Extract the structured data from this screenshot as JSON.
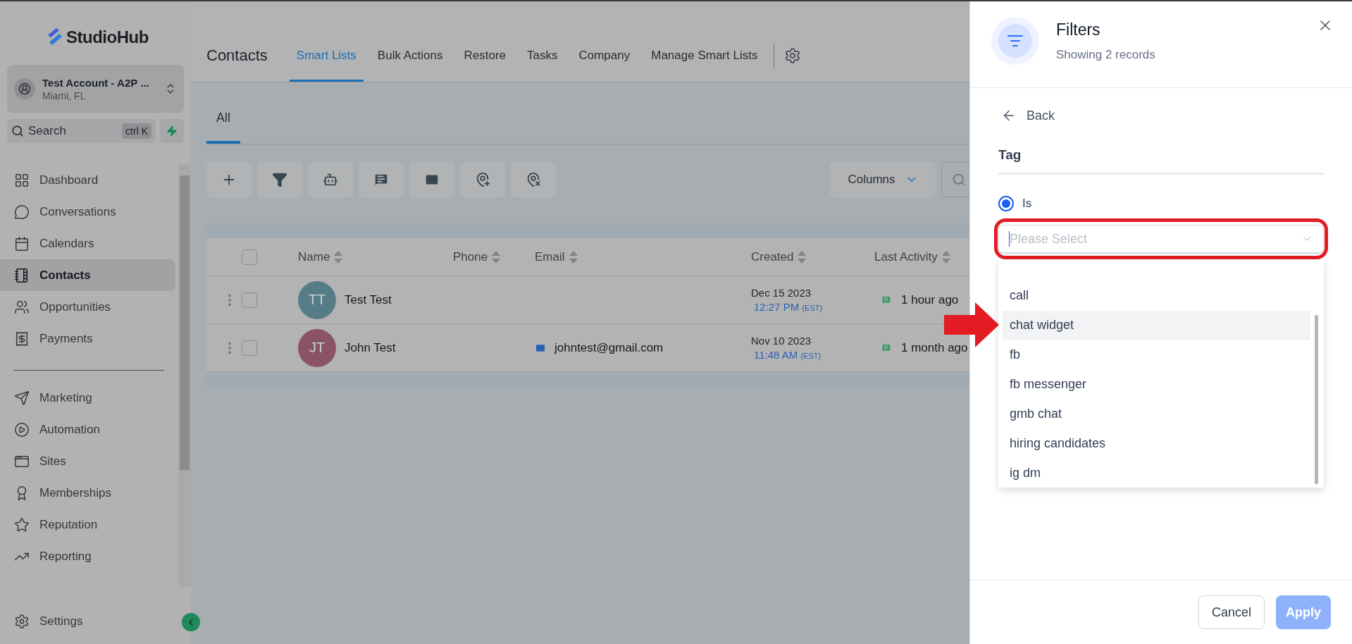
{
  "sidebar": {
    "logo": "StudioHub",
    "account": {
      "name": "Test Account - A2P ...",
      "location": "Miami, FL"
    },
    "search": {
      "placeholder": "Search",
      "shortcut": "ctrl K"
    },
    "nav_primary": [
      {
        "label": "Dashboard",
        "selected": false
      },
      {
        "label": "Conversations",
        "selected": false
      },
      {
        "label": "Calendars",
        "selected": false
      },
      {
        "label": "Contacts",
        "selected": true
      },
      {
        "label": "Opportunities",
        "selected": false
      },
      {
        "label": "Payments",
        "selected": false
      }
    ],
    "nav_secondary": [
      {
        "label": "Marketing",
        "selected": false
      },
      {
        "label": "Automation",
        "selected": false
      },
      {
        "label": "Sites",
        "selected": false
      },
      {
        "label": "Memberships",
        "selected": false
      },
      {
        "label": "Reputation",
        "selected": false
      },
      {
        "label": "Reporting",
        "selected": false
      }
    ],
    "settings": {
      "label": "Settings"
    }
  },
  "header": {
    "title": "Contacts",
    "tabs": [
      {
        "label": "Smart Lists",
        "selected": true
      },
      {
        "label": "Bulk Actions",
        "selected": false
      },
      {
        "label": "Restore",
        "selected": false
      },
      {
        "label": "Tasks",
        "selected": false
      },
      {
        "label": "Company",
        "selected": false
      },
      {
        "label": "Manage Smart Lists",
        "selected": false
      }
    ]
  },
  "subtabs": [
    {
      "label": "All",
      "selected": true
    }
  ],
  "toolbar": {
    "columns_button": "Columns"
  },
  "table": {
    "select_all": {
      "checked": false
    },
    "columns": [
      "Name",
      "Phone",
      "Email",
      "Created",
      "Last Activity"
    ],
    "rows": [
      {
        "initials": "TT",
        "color": "#567d87",
        "name": "Test Test",
        "checked": false,
        "phone": "",
        "email": "",
        "created_date": "Dec 15 2023",
        "created_time": "12:27 PM",
        "timezone": "(EST)",
        "last_activity": "1 hour ago"
      },
      {
        "initials": "JT",
        "color": "#8a5366",
        "name": "John Test",
        "checked": false,
        "phone": "",
        "email": "johntest@gmail.com",
        "created_date": "Nov 10 2023",
        "created_time": "11:48 AM",
        "timezone": "(EST)",
        "last_activity": "1 month ago"
      }
    ]
  },
  "filter_panel": {
    "title": "Filters",
    "subtitle": "Showing 2 records",
    "back": "Back",
    "field_label": "Tag",
    "condition": {
      "label": "Is",
      "selected": true
    },
    "select": {
      "placeholder": "Please Select"
    },
    "options": [
      {
        "label": "call",
        "highlighted": false
      },
      {
        "label": "chat widget",
        "highlighted": true
      },
      {
        "label": "fb",
        "highlighted": false
      },
      {
        "label": "fb messenger",
        "highlighted": false
      },
      {
        "label": "gmb chat",
        "highlighted": false
      },
      {
        "label": "hiring candidates",
        "highlighted": false
      },
      {
        "label": "ig dm",
        "highlighted": false
      }
    ],
    "buttons": {
      "cancel": "Cancel",
      "apply": {
        "label": "Apply",
        "disabled": true
      }
    }
  }
}
